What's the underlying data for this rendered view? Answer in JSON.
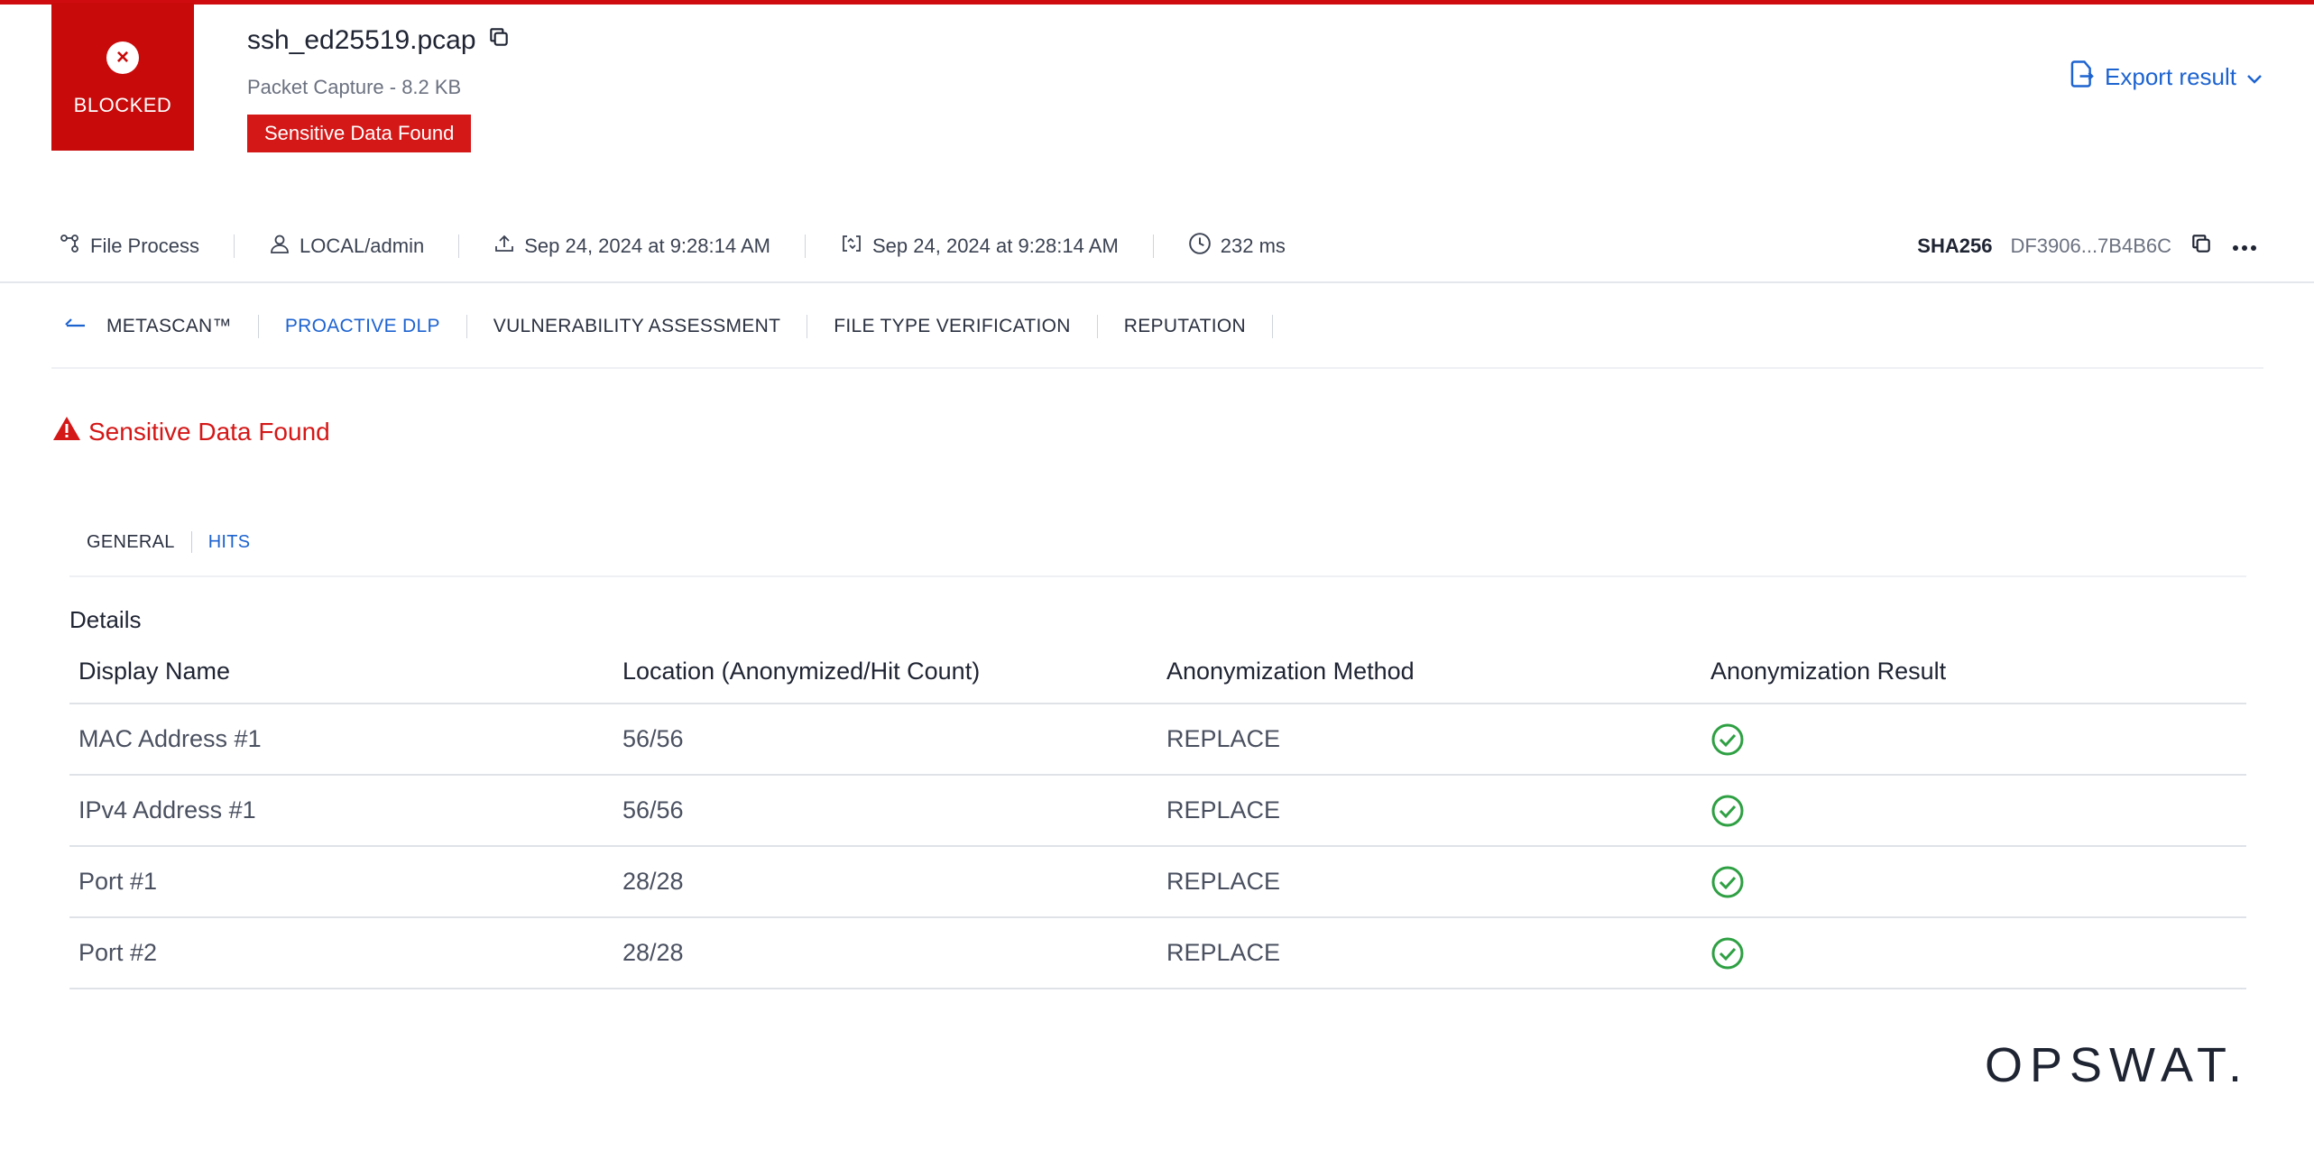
{
  "status": {
    "label": "BLOCKED",
    "icon": "close-circle-icon",
    "color": "#c80a0a"
  },
  "file": {
    "name": "ssh_ed25519.pcap",
    "type_size": "Packet Capture - 8.2 KB",
    "tag": "Sensitive Data Found"
  },
  "export": {
    "label": "Export result"
  },
  "meta": {
    "process": "File Process",
    "user": "LOCAL/admin",
    "uploaded": "Sep 24, 2024 at 9:28:14 AM",
    "processed": "Sep 24, 2024 at 9:28:14 AM",
    "duration": "232 ms",
    "hash_label": "SHA256",
    "hash_value": "DF3906...7B4B6C"
  },
  "tabs": [
    "METASCAN™",
    "PROACTIVE DLP",
    "VULNERABILITY ASSESSMENT",
    "FILE TYPE VERIFICATION",
    "REPUTATION"
  ],
  "active_tab": "PROACTIVE DLP",
  "alert": {
    "text": "Sensitive Data Found"
  },
  "subtabs": [
    "GENERAL",
    "HITS"
  ],
  "active_subtab": "HITS",
  "details": {
    "title": "Details",
    "columns": [
      "Display Name",
      "Location (Anonymized/Hit Count)",
      "Anonymization Method",
      "Anonymization Result"
    ],
    "rows": [
      {
        "name": "MAC Address #1",
        "location": "56/56",
        "method": "REPLACE",
        "result": "success"
      },
      {
        "name": "IPv4 Address #1",
        "location": "56/56",
        "method": "REPLACE",
        "result": "success"
      },
      {
        "name": "Port #1",
        "location": "28/28",
        "method": "REPLACE",
        "result": "success"
      },
      {
        "name": "Port #2",
        "location": "28/28",
        "method": "REPLACE",
        "result": "success"
      }
    ]
  },
  "brand": {
    "logo_text": "OPSWAT."
  },
  "colors": {
    "accent": "#1d63d0",
    "danger": "#d41717",
    "success": "#2ea043"
  }
}
